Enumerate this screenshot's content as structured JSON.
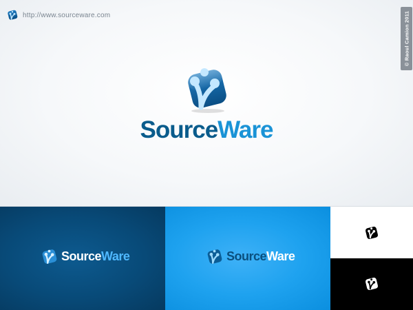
{
  "header": {
    "url": "http://www.sourceware.com",
    "credit": "© Raoul Camion 2011"
  },
  "brand": {
    "name_part1": "Source",
    "name_part2": "Ware"
  },
  "colors": {
    "brand_dark": "#0a5c8c",
    "brand_light": "#1a93d6",
    "panel_dark": "#084a78",
    "panel_blue": "#1ea2ef",
    "panel_white": "#ffffff",
    "panel_black": "#000000"
  },
  "icons": {
    "logo": "water-drop-square-icon"
  },
  "variants": [
    {
      "background": "dark-blue",
      "style": "icon-with-wordmark"
    },
    {
      "background": "light-blue",
      "style": "icon-with-wordmark"
    },
    {
      "background": "white",
      "style": "icon-only"
    },
    {
      "background": "black",
      "style": "icon-only"
    }
  ]
}
